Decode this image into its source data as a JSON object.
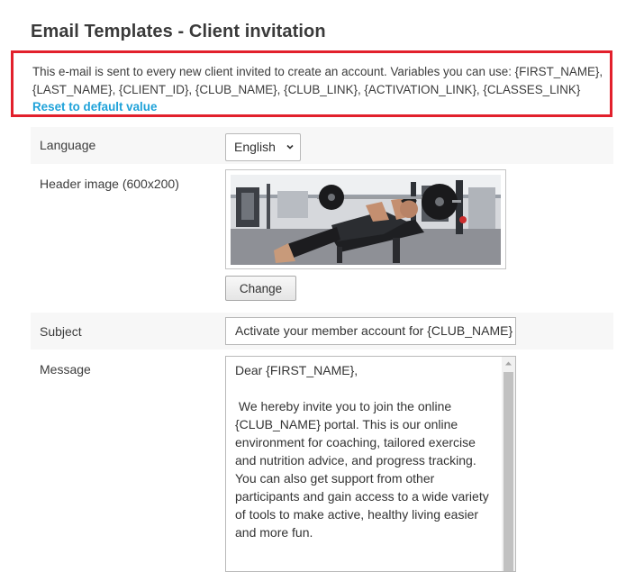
{
  "page": {
    "title": "Email Templates - Client invitation"
  },
  "info": {
    "description": "This e-mail is sent to every new client invited to create an account. Variables you can use: {FIRST_NAME}, {LAST_NAME}, {CLIENT_ID}, {CLUB_NAME}, {CLUB_LINK}, {ACTIVATION_LINK}, {CLASSES_LINK}",
    "reset_label": "Reset to default value"
  },
  "form": {
    "language": {
      "label": "Language",
      "selected": "English"
    },
    "header_image": {
      "label": "Header image (600x200)",
      "change_label": "Change"
    },
    "subject": {
      "label": "Subject",
      "value": "Activate your member account for {CLUB_NAME}"
    },
    "message": {
      "label": "Message",
      "value": "Dear {FIRST_NAME},\n\n We hereby invite you to join the online {CLUB_NAME} portal. This is our online environment for coaching, tailored exercise and nutrition advice, and progress tracking. You can also get support from other participants and gain access to a wide variety of tools to make active, healthy living easier and more fun."
    }
  },
  "colors": {
    "highlight_border": "#e2202c",
    "link": "#1fa2d9",
    "row_shade": "#f7f7f7"
  },
  "icons": {
    "select_arrow": "chevron-down-icon",
    "scroll_up": "scroll-up-arrow-icon"
  }
}
